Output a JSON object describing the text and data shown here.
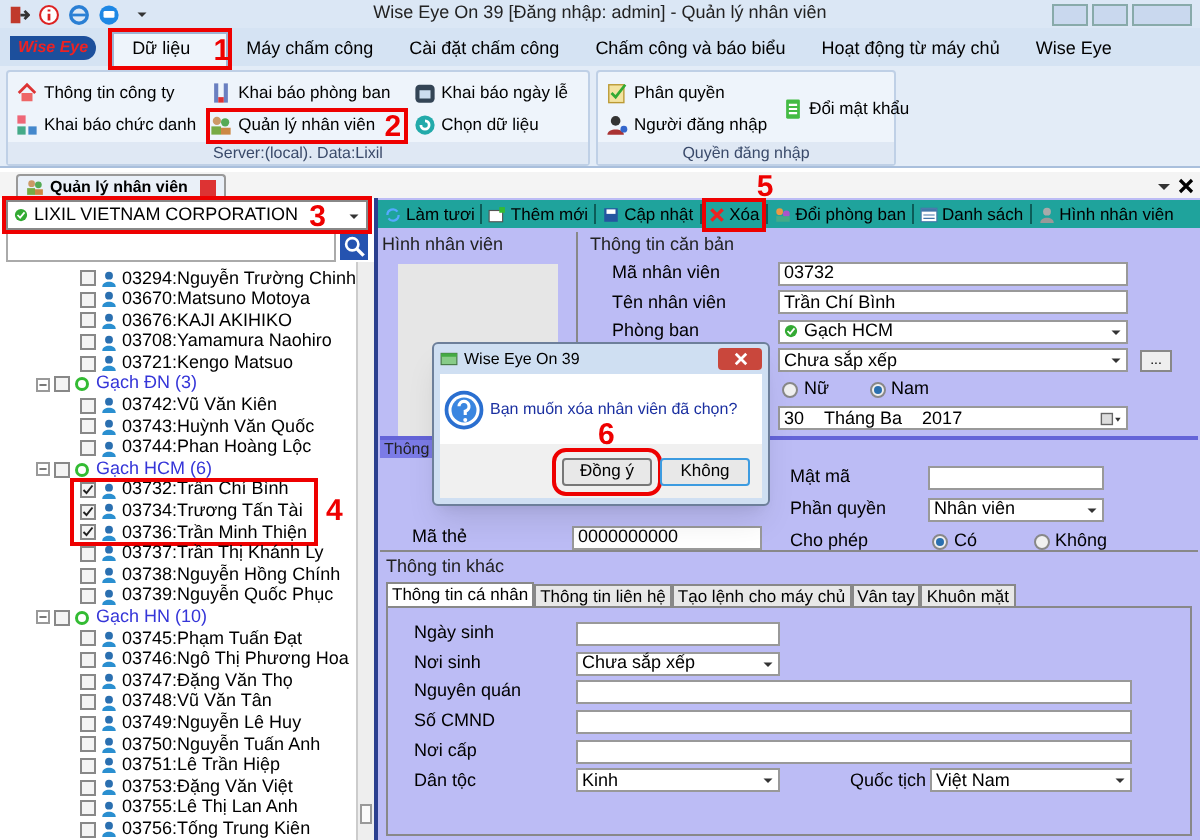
{
  "window": {
    "title": "Wise Eye On 39 [Đăng nhập: admin] - Quản lý nhân viên"
  },
  "app_logo": "Wise Eye",
  "ribbon_tabs": [
    {
      "label": "Dữ liệu",
      "selected": true,
      "callout": "1"
    },
    {
      "label": "Máy chấm công",
      "selected": false
    },
    {
      "label": "Cài đặt chấm công",
      "selected": false
    },
    {
      "label": "Chấm công và báo biểu",
      "selected": false
    },
    {
      "label": "Hoạt động từ máy chủ",
      "selected": false
    },
    {
      "label": "Wise Eye",
      "selected": false
    }
  ],
  "ribbon_groups": [
    {
      "caption": "Server:(local). Data:Lixil",
      "items": [
        {
          "label": "Thông tin công ty"
        },
        {
          "label": "Khai báo chức danh"
        },
        {
          "label": "Khai báo phòng ban"
        },
        {
          "label": "Quản lý nhân viên",
          "callout": "2"
        },
        {
          "label": "Khai báo ngày lễ"
        },
        {
          "label": "Chọn dữ liệu"
        }
      ]
    },
    {
      "caption": "Quyền đăng nhập",
      "items": [
        {
          "label": "Phân quyền"
        },
        {
          "label": "Người đăng nhập"
        },
        {
          "label": "Đổi mật khẩu"
        }
      ]
    }
  ],
  "document_tab": {
    "label": "Quản lý nhân viên"
  },
  "company_combo": {
    "value": "LIXIL VIETNAM CORPORATION",
    "callout": "3"
  },
  "tree": {
    "groups": [
      {
        "children": [
          {
            "label": "03294:Nguyễn Trường Chinh",
            "checked": false
          },
          {
            "label": "03670:Matsuno Motoya",
            "checked": false
          },
          {
            "label": "03676:KAJI AKIHIKO",
            "checked": false
          },
          {
            "label": "03708:Yamamura Naohiro",
            "checked": false
          },
          {
            "label": "03721:Kengo Matsuo",
            "checked": false
          }
        ]
      },
      {
        "label": "Gạch ĐN (3)",
        "expanded": true,
        "checked": false,
        "children": [
          {
            "label": "03742:Vũ Văn Kiên",
            "checked": false
          },
          {
            "label": "03743:Huỳnh Văn Quốc",
            "checked": false
          },
          {
            "label": "03744:Phan Hoàng Lộc",
            "checked": false
          }
        ]
      },
      {
        "label": "Gạch HCM (6)",
        "expanded": true,
        "checked": false,
        "callout": "4",
        "children": [
          {
            "label": "03732:Trần Chí Bình",
            "checked": true
          },
          {
            "label": "03734:Trương Tấn Tài",
            "checked": true
          },
          {
            "label": "03736:Trần Minh Thiện",
            "checked": true
          },
          {
            "label": "03737:Trần Thị Khánh Ly",
            "checked": false
          },
          {
            "label": "03738:Nguyễn Hồng Chính",
            "checked": false
          },
          {
            "label": "03739:Nguyễn Quốc Phục",
            "checked": false
          }
        ]
      },
      {
        "label": "Gạch HN (10)",
        "expanded": true,
        "checked": false,
        "children": [
          {
            "label": "03745:Phạm Tuấn Đạt",
            "checked": false
          },
          {
            "label": "03746:Ngô Thị Phương Hoa",
            "checked": false
          },
          {
            "label": "03747:Đặng Văn Thọ",
            "checked": false
          },
          {
            "label": "03748:Vũ Văn Tân",
            "checked": false
          },
          {
            "label": "03749:Nguyễn Lê Huy",
            "checked": false
          },
          {
            "label": "03750:Nguyễn Tuấn Anh",
            "checked": false
          },
          {
            "label": "03751:Lê Trần Hiệp",
            "checked": false
          },
          {
            "label": "03753:Đặng Văn Việt",
            "checked": false
          },
          {
            "label": "03755:Lê Thị Lan Anh",
            "checked": false
          },
          {
            "label": "03756:Tống Trung Kiên",
            "checked": false
          }
        ]
      }
    ]
  },
  "toolbar": [
    {
      "label": "Làm tươi"
    },
    {
      "label": "Thêm mới"
    },
    {
      "label": "Cập nhật"
    },
    {
      "label": "Xóa",
      "callout": "5"
    },
    {
      "label": "Đổi phòng ban"
    },
    {
      "label": "Danh sách"
    },
    {
      "label": "Hình nhân viên"
    }
  ],
  "photo_group": {
    "title": "Hình nhân viên"
  },
  "basic_info": {
    "title": "Thông tin căn bản",
    "fields": [
      {
        "kind": "text",
        "label": "Mã nhân viên",
        "value": "03732"
      },
      {
        "kind": "text",
        "label": "Tên nhân viên",
        "value": "Trần Chí Bình"
      },
      {
        "kind": "status_dropdown",
        "label": "Phòng ban",
        "value": "Gạch HCM"
      },
      {
        "kind": "dropdown_button",
        "value": "Chưa sắp xếp",
        "button": "..."
      },
      {
        "kind": "radio",
        "options": [
          {
            "label": "Nữ",
            "selected": false
          },
          {
            "label": "Nam",
            "selected": true
          }
        ]
      },
      {
        "kind": "date",
        "day": "30",
        "month": "Tháng Ba",
        "year": "2017"
      }
    ]
  },
  "account": {
    "title": "Thông",
    "left": [
      {
        "kind": "text",
        "label": "Mã thẻ",
        "value": "0000000000"
      }
    ],
    "right": [
      {
        "kind": "password",
        "label": "Mật mã"
      },
      {
        "kind": "dropdown",
        "label": "Phần quyền",
        "value": "Nhân viên"
      },
      {
        "kind": "radio",
        "label": "Cho phép",
        "options": [
          {
            "label": "Có",
            "selected": true
          },
          {
            "label": "Không",
            "selected": false
          }
        ]
      }
    ]
  },
  "other_info": {
    "title": "Thông tin khác",
    "tabs": [
      {
        "label": "Thông tin cá nhân",
        "selected": true
      },
      {
        "label": "Thông tin liên hệ",
        "selected": false
      },
      {
        "label": "Tạo lệnh cho máy chủ",
        "selected": false
      },
      {
        "label": "Vân tay",
        "selected": false
      },
      {
        "label": "Khuôn mặt",
        "selected": false
      }
    ],
    "fields": [
      {
        "kind": "text_short",
        "label": "Ngày sinh"
      },
      {
        "kind": "dropdown_short",
        "label": "Nơi sinh",
        "value": "Chưa sắp xếp"
      },
      {
        "kind": "text_wide",
        "label": "Nguyên quán"
      },
      {
        "kind": "text_wide",
        "label": "Số CMND"
      },
      {
        "kind": "text_wide",
        "label": "Nơi cấp"
      },
      {
        "kind": "dropdown_pair",
        "label": "Dân tộc",
        "value": "Kinh",
        "label2": "Quốc tịch",
        "value2": "Việt Nam"
      }
    ]
  },
  "dialog": {
    "title": "Wise Eye On 39",
    "message": "Bạn muốn xóa nhân viên đã chọn?",
    "buttons": [
      {
        "label": "Đồng ý",
        "focused": false,
        "callout": "6"
      },
      {
        "label": "Không",
        "focused": true
      }
    ]
  }
}
